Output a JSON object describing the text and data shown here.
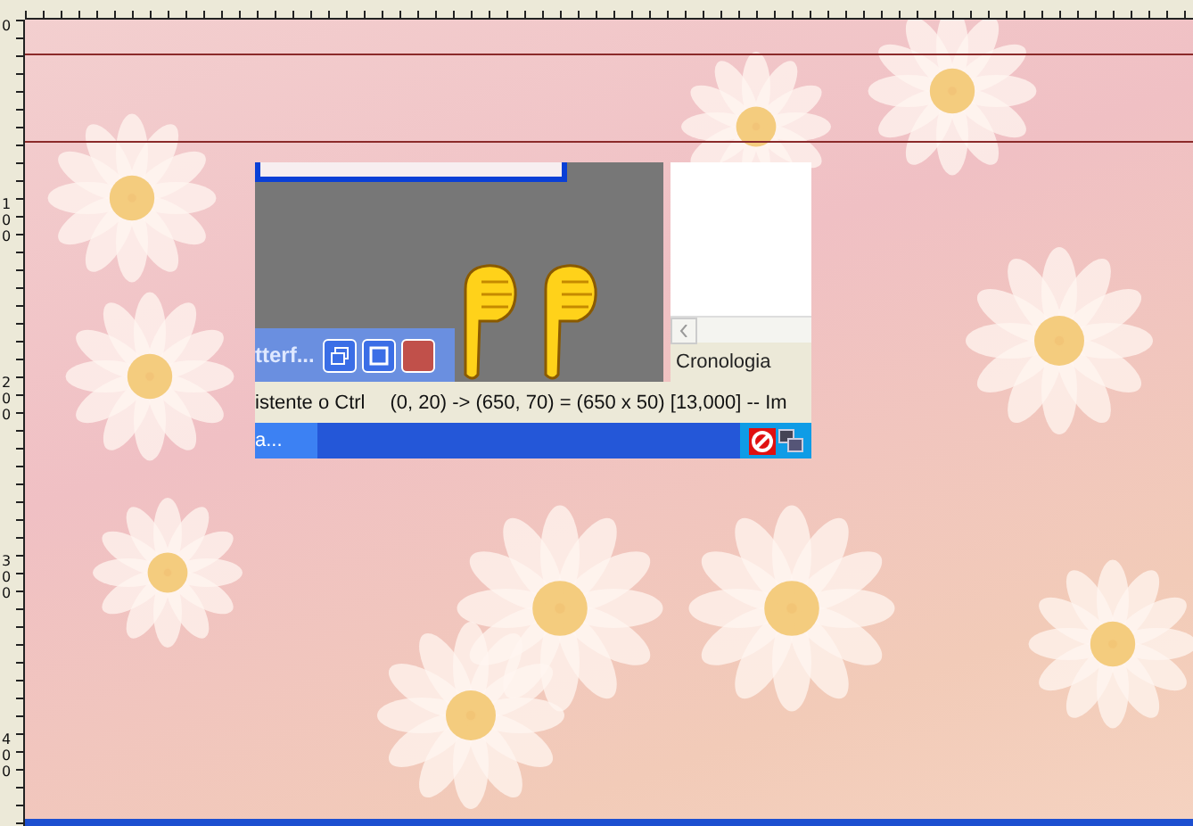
{
  "rulers": {
    "vertical_labels": [
      "0",
      "100",
      "200",
      "300",
      "400"
    ]
  },
  "screenshot": {
    "window_caption": "tterf...",
    "panel_title": "Cronologia",
    "status_bar": [
      "istente o Ctrl",
      "(0, 20) -> (650, 70) = (650 x 50) [13,000] -- Im"
    ],
    "taskbar_button": "a..."
  }
}
